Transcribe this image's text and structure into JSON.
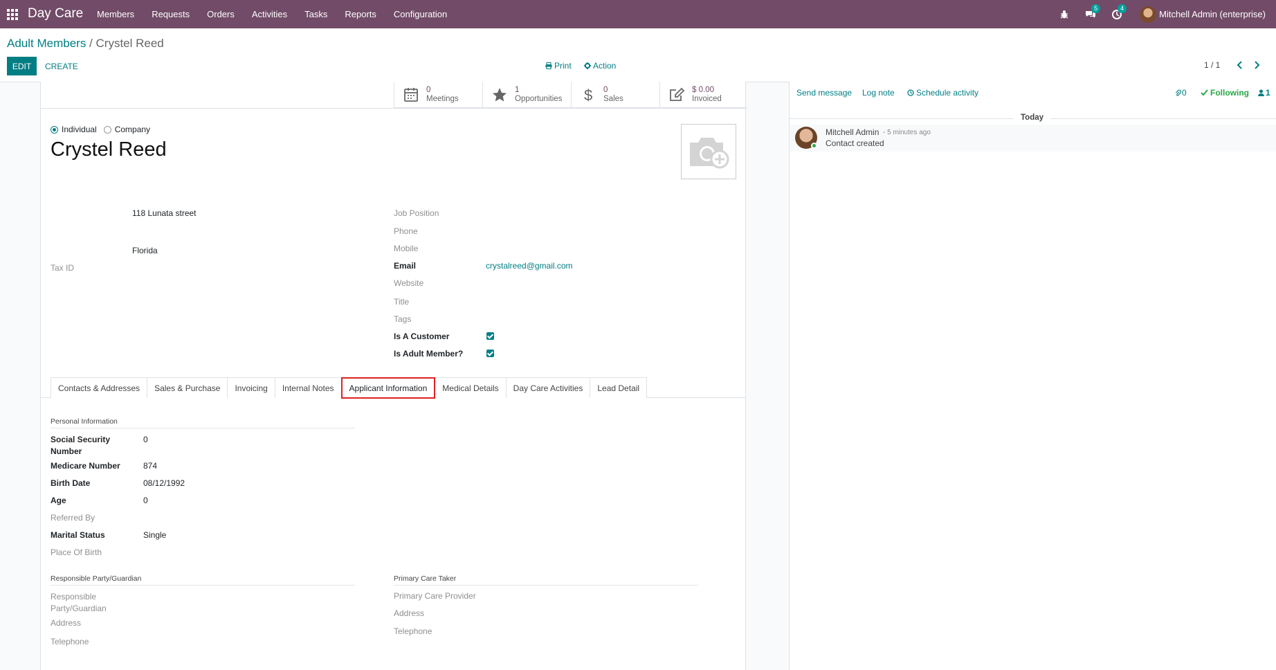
{
  "navbar": {
    "app_name": "Day Care",
    "menu": [
      "Members",
      "Requests",
      "Orders",
      "Activities",
      "Tasks",
      "Reports",
      "Configuration"
    ],
    "messages_count": "5",
    "activities_count": "4",
    "user_name": "Mitchell Admin (enterprise)"
  },
  "breadcrumb": {
    "parent": "Adult Members",
    "separator": " / ",
    "current": "Crystel Reed"
  },
  "control": {
    "edit_label": "EDIT",
    "create_label": "CREATE",
    "print_label": "Print",
    "action_label": "Action",
    "pager": "1 / 1"
  },
  "stat_buttons": [
    {
      "value": "0",
      "label": "Meetings",
      "icon": "calendar-icon"
    },
    {
      "value": "1",
      "label": "Opportunities",
      "icon": "star-icon"
    },
    {
      "value": "0",
      "label": "Sales",
      "icon": "dollar-icon"
    },
    {
      "value": "$ 0.00",
      "label": "Invoiced",
      "icon": "pencil-square-icon"
    }
  ],
  "company_type": {
    "individual": "Individual",
    "company": "Company",
    "selected": "Individual"
  },
  "record": {
    "name": "Crystel Reed"
  },
  "address": {
    "street": "118 Lunata street",
    "state": "Florida",
    "tax_id_label": "Tax ID"
  },
  "fields_right": {
    "job_position": "Job Position",
    "phone": "Phone",
    "mobile": "Mobile",
    "email_label": "Email",
    "email_value": "crystalreed@gmail.com",
    "website": "Website",
    "title": "Title",
    "tags": "Tags",
    "is_customer_label": "Is A Customer",
    "is_customer": true,
    "is_adult_label": "Is Adult Member?",
    "is_adult": true
  },
  "tabs": [
    "Contacts & Addresses",
    "Sales & Purchase",
    "Invoicing",
    "Internal Notes",
    "Applicant Information",
    "Medical Details",
    "Day Care Activities",
    "Lead Detail"
  ],
  "active_tab": "Applicant Information",
  "personal": {
    "section": "Personal Information",
    "ssn_label": "Social Security Number",
    "ssn_value": "0",
    "medicare_label": "Medicare Number",
    "medicare_value": "874",
    "birth_label": "Birth Date",
    "birth_value": "08/12/1992",
    "age_label": "Age",
    "age_value": "0",
    "referred_label": "Referred By",
    "marital_label": "Marital Status",
    "marital_value": "Single",
    "pob_label": "Place Of Birth"
  },
  "guardian": {
    "section": "Responsible Party/Guardian",
    "party_label": "Responsible Party/Guardian",
    "address_label": "Address",
    "telephone_label": "Telephone"
  },
  "caretaker": {
    "section": "Primary Care Taker",
    "provider_label": "Primary Care Provider",
    "address_label": "Address",
    "telephone_label": "Telephone"
  },
  "chatter": {
    "send_message": "Send message",
    "log_note": "Log note",
    "schedule_activity": "Schedule activity",
    "attachments": "0",
    "following": "Following",
    "followers": "1",
    "today": "Today",
    "message_author": "Mitchell Admin",
    "message_time": "- 5 minutes ago",
    "message_body": "Contact created"
  },
  "colors": {
    "navbar": "#714b67",
    "primary": "#017e84",
    "active_tab_border": "#e02020",
    "following": "#28a745"
  }
}
